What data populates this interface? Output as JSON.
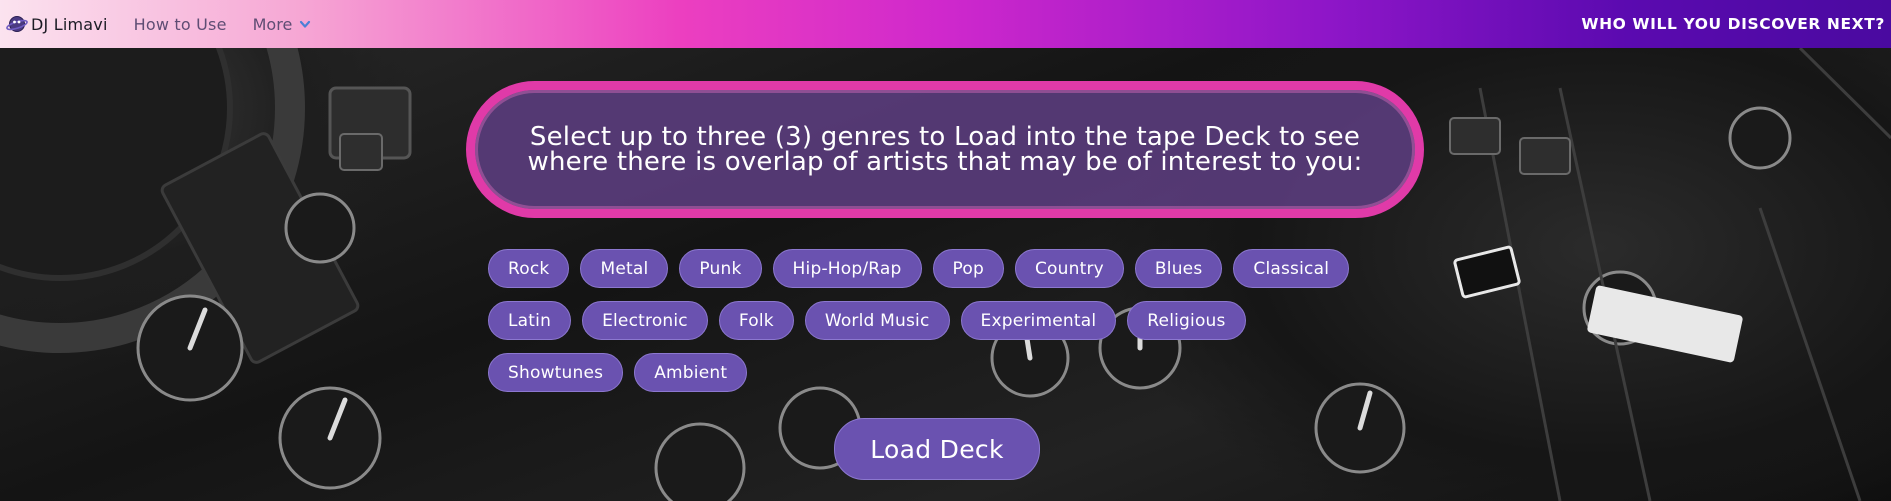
{
  "nav": {
    "brand": "DJ Limavi",
    "brand_icon": "planet-logo-icon",
    "links": [
      {
        "label": "How to Use"
      },
      {
        "label": "More"
      }
    ],
    "more_icon": "chevron-down-icon",
    "tagline": "WHO WILL YOU DISCOVER NEXT?"
  },
  "main": {
    "prompt": "Select up to three (3) genres to Load into the tape Deck to see where there is overlap of artists that may be of interest to you:",
    "genres": [
      [
        "Rock",
        "Metal",
        "Punk",
        "Hip-Hop/Rap",
        "Pop",
        "Country",
        "Blues",
        "Classical"
      ],
      [
        "Latin",
        "Electronic",
        "Folk",
        "World Music",
        "Experimental",
        "Religious"
      ],
      [
        "Showtunes",
        "Ambient"
      ]
    ],
    "load_button": "Load Deck"
  },
  "colors": {
    "accent_border": "#e03aa8",
    "chip_fill": "#6a52b0",
    "nav_gradient_start": "#fbe3ef",
    "nav_gradient_end": "#4a0aa0"
  }
}
